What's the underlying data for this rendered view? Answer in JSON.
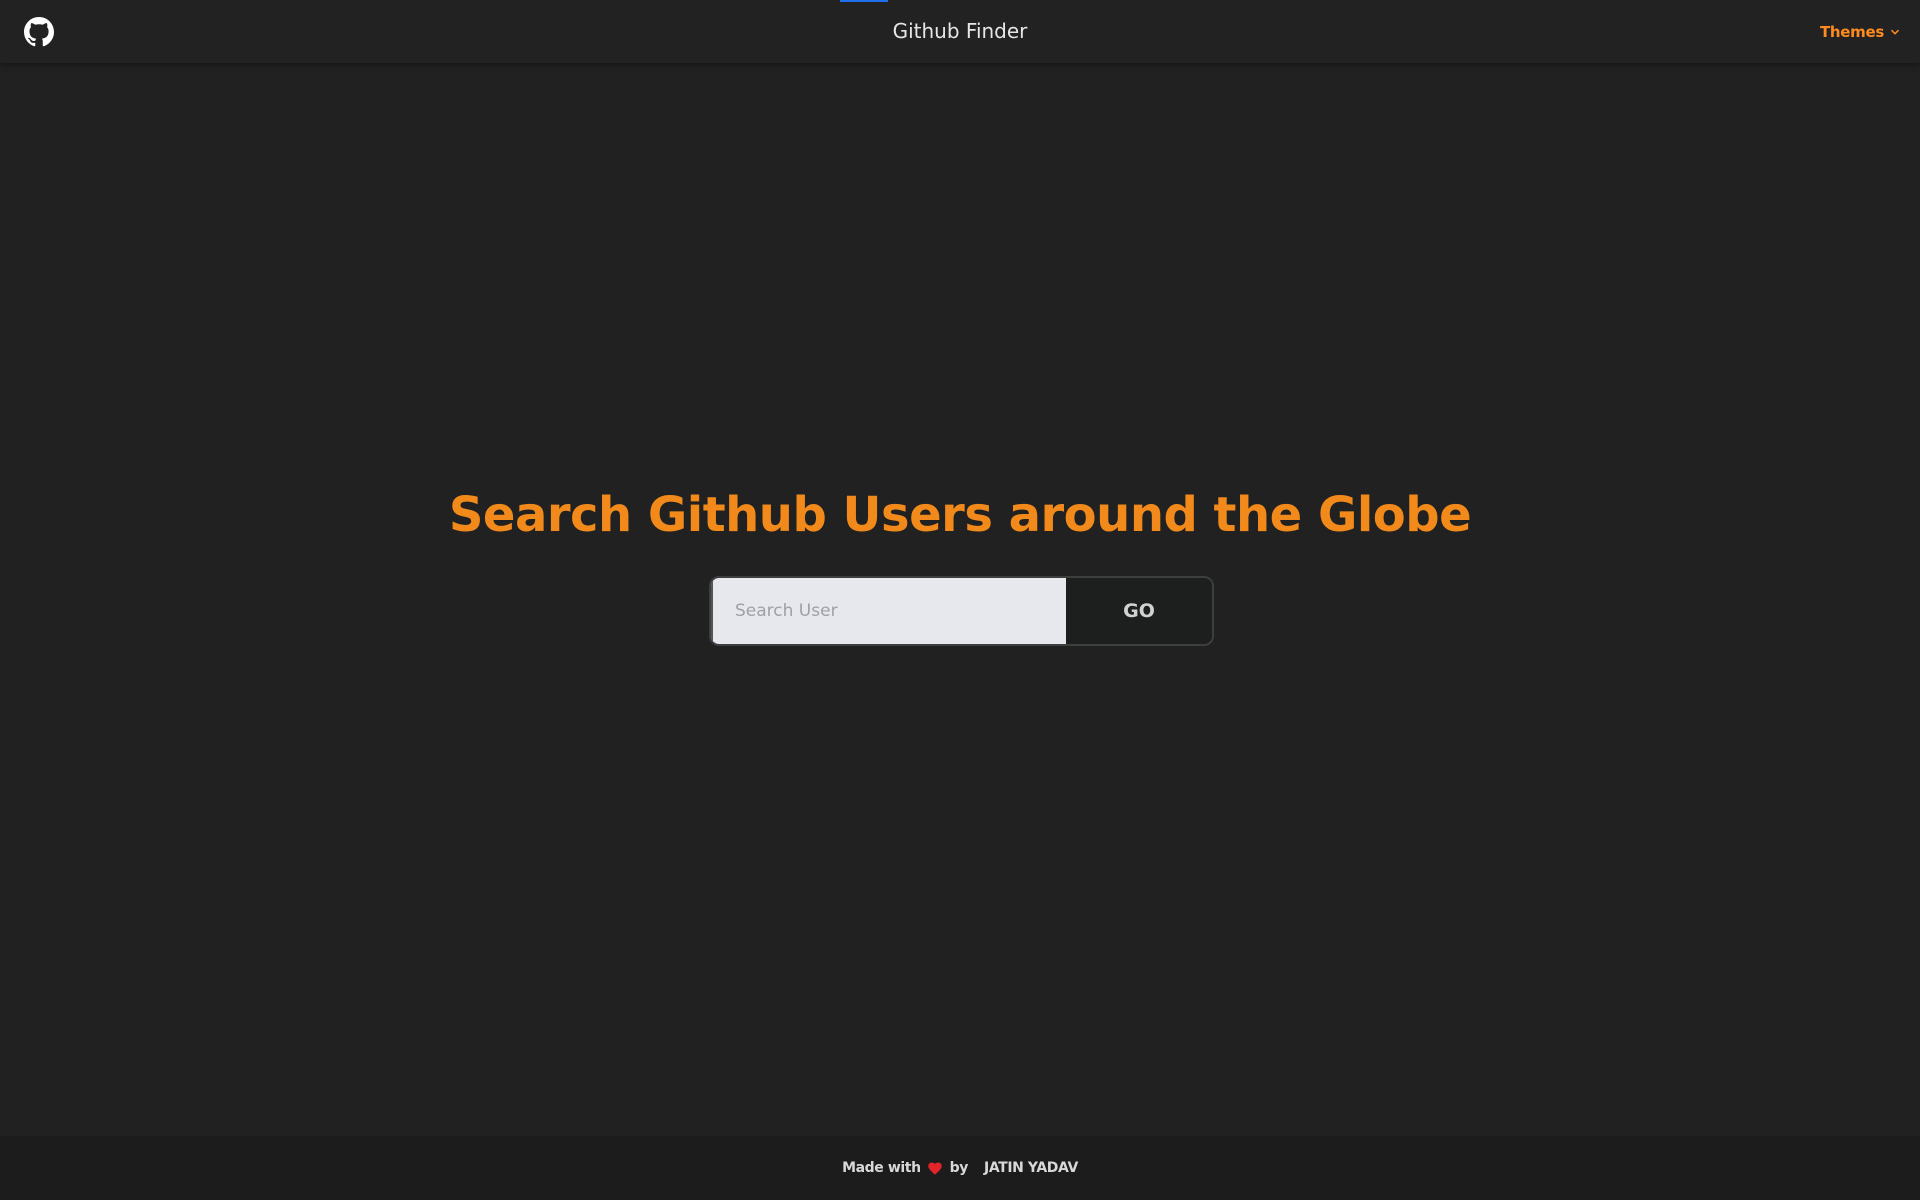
{
  "navbar": {
    "title": "Github Finder",
    "logo_icon": "github-icon",
    "themes_label": "Themes",
    "themes_icon": "chevron-down-icon"
  },
  "hero": {
    "title": "Search Github Users around the Globe"
  },
  "search": {
    "placeholder": "Search User",
    "value": "",
    "button_label": "GO"
  },
  "footer": {
    "made_with": "Made with",
    "heart_icon": "heart-icon",
    "by": "by",
    "author": "JATIN YADAV"
  },
  "colors": {
    "background": "#212121",
    "accent": "#f28a1b",
    "heart": "#e3242b"
  }
}
